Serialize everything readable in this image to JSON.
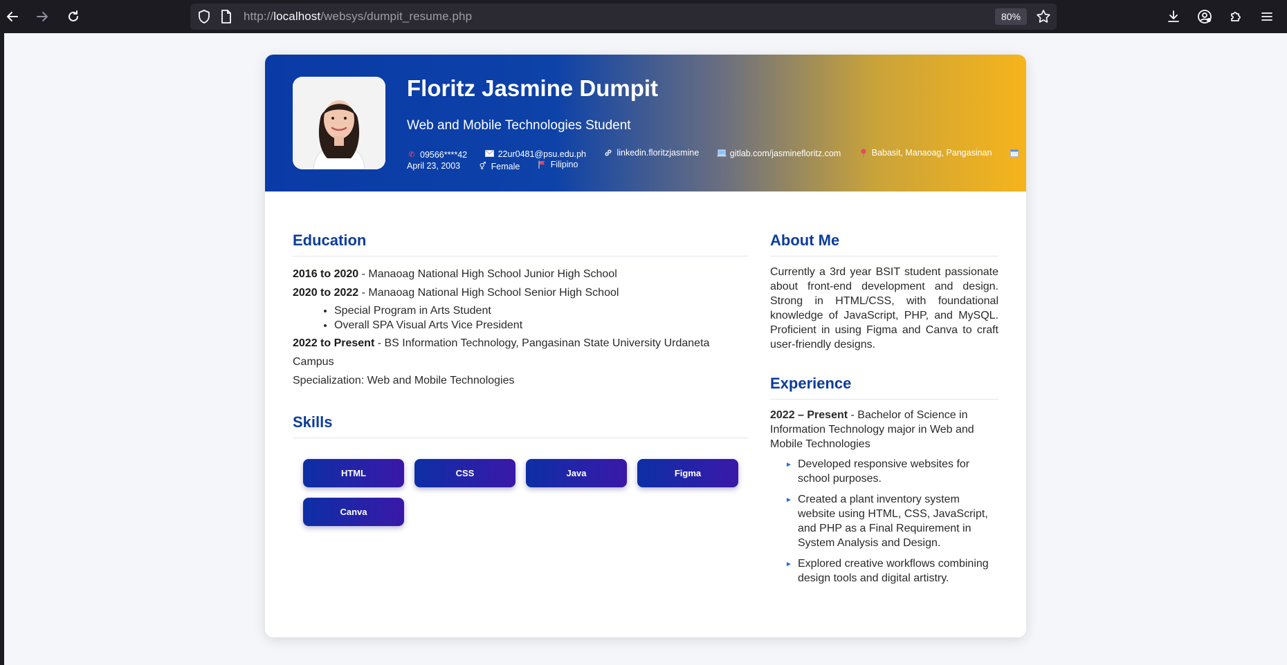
{
  "browser": {
    "url_prefix": "http://",
    "url_host": "localhost",
    "url_path": "/websys/dumpit_resume.php",
    "zoom": "80%"
  },
  "profile": {
    "name": "Floritz Jasmine Dumpit",
    "title": "Web and Mobile Technologies Student",
    "phone": "09566****42",
    "email": "22ur0481@psu.edu.ph",
    "linkedin": "linkedin.floritzjasmine",
    "gitlab": "gitlab.com/jasminefloritz.com",
    "location": "Babasit, Manaoag, Pangasinan",
    "birthday": "April 23, 2003",
    "gender": "Female",
    "nationality": "Filipino"
  },
  "education": {
    "heading": "Education",
    "entries": [
      {
        "years": "2016 to 2020",
        "text": "- Manaoag National High School Junior High School"
      },
      {
        "years": "2020 to 2022",
        "text": "- Manaoag National High School Senior High School"
      },
      {
        "years": "2022 to Present",
        "text": "- BS Information Technology, Pangasinan State University Urdaneta Campus"
      }
    ],
    "shs_bullets": [
      "Special Program in Arts Student",
      "Overall SPA Visual Arts Vice President"
    ],
    "specialization": "Specialization: Web and Mobile Technologies"
  },
  "skills": {
    "heading": "Skills",
    "items": [
      "HTML",
      "CSS",
      "Java",
      "Figma",
      "Canva"
    ]
  },
  "about": {
    "heading": "About Me",
    "text": "Currently a 3rd year BSIT student passionate about front-end development and design. Strong in HTML/CSS, with foundational knowledge of JavaScript, PHP, and MySQL. Proficient in using Figma and Canva to craft user-friendly designs."
  },
  "experience": {
    "heading": "Experience",
    "period": "2022 – Present",
    "description": "- Bachelor of Science in Information Technology major in Web and Mobile Technologies",
    "bullets": [
      "Developed responsive websites for school purposes.",
      "Created a plant inventory system website using HTML, CSS, JavaScript, and PHP as a Final Requirement in System Analysis and Design.",
      "Explored creative workflows combining design tools and digital artistry."
    ]
  },
  "colors": {
    "header_start": "#0a3aa6",
    "header_end": "#f6b41b",
    "heading": "#0c3c9c",
    "skill_button": "#2a22a8"
  }
}
